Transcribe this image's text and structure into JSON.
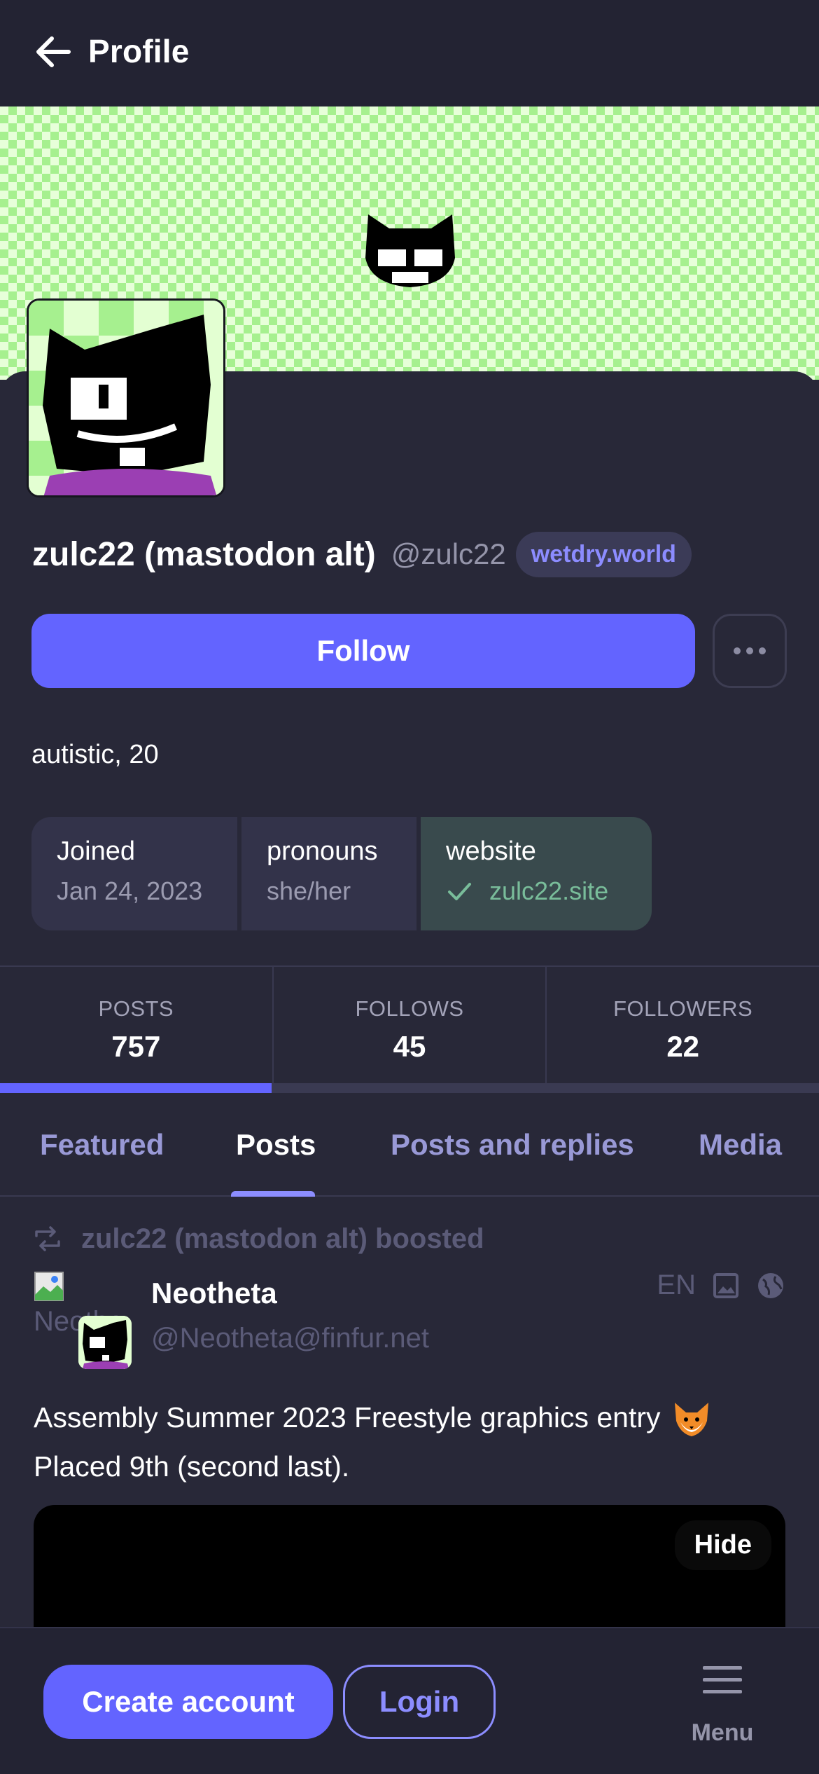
{
  "header": {
    "title": "Profile",
    "back_icon": "arrow-left-icon"
  },
  "profile": {
    "display_name": "zulc22 (mastodon alt)",
    "handle": "@zulc22",
    "domain": "wetdry.world",
    "follow_label": "Follow",
    "bio": "autistic, 20",
    "fields": [
      {
        "label": "Joined",
        "value": "Jan 24, 2023",
        "verified": false
      },
      {
        "label": "pronouns",
        "value": "she/her",
        "verified": false
      },
      {
        "label": "website",
        "value": "zulc22.site",
        "verified": true
      }
    ]
  },
  "stats": [
    {
      "label": "POSTS",
      "value": "757"
    },
    {
      "label": "FOLLOWS",
      "value": "45"
    },
    {
      "label": "FOLLOWERS",
      "value": "22"
    }
  ],
  "tabs": [
    {
      "label": "Featured",
      "active": false
    },
    {
      "label": "Posts",
      "active": true
    },
    {
      "label": "Posts and replies",
      "active": false
    },
    {
      "label": "Media",
      "active": false
    }
  ],
  "post": {
    "boosted_by": "zulc22 (mastodon alt) boosted",
    "broken_avatar_alt": "Neotheta",
    "author_name": "Neotheta",
    "author_acct": "@Neotheta@finfur.net",
    "language": "EN",
    "text_line1": "Assembly Summer 2023 Freestyle graphics entry",
    "text_line2": "Placed 9th (second last).",
    "hide_label": "Hide"
  },
  "bottom": {
    "create_account": "Create account",
    "login": "Login",
    "menu": "Menu"
  },
  "colors": {
    "accent": "#6364ff",
    "background": "#282838",
    "verified": "#79bd9a",
    "muted": "#5b5b78"
  }
}
